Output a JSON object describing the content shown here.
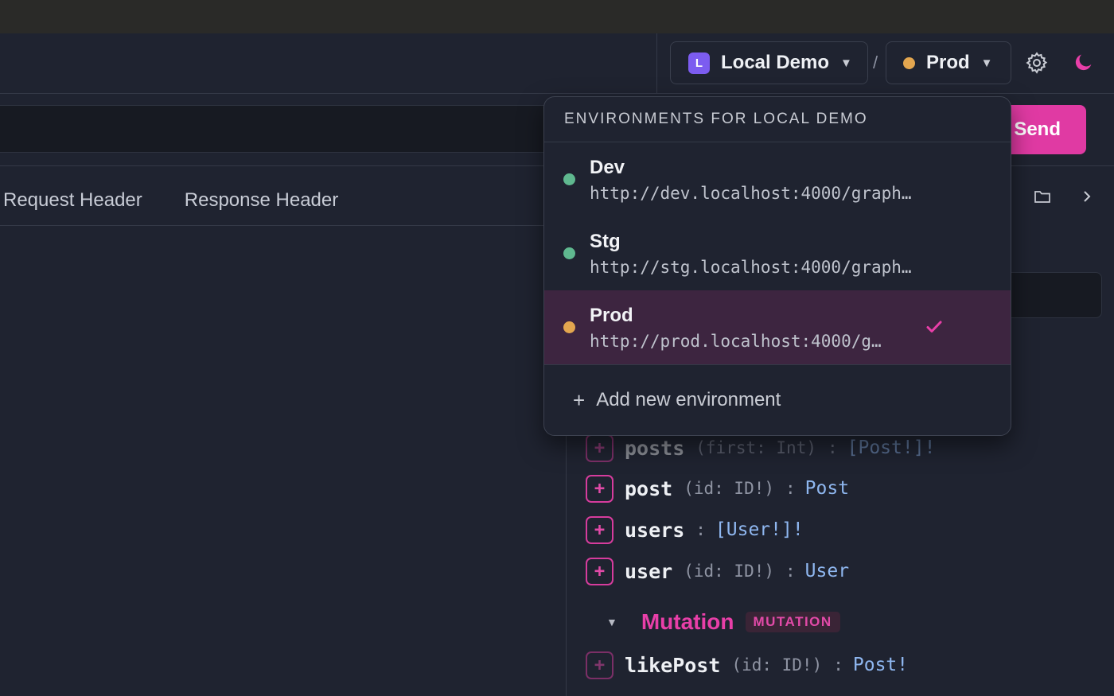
{
  "colors": {
    "accent": "#e03aa3",
    "workspace_badge": "#7c5cf0",
    "env_dev": "#5fb88f",
    "env_stg": "#5fb88f",
    "env_prod": "#e3a64f",
    "type_blue": "#8fb7f0"
  },
  "header": {
    "workspace": {
      "badge": "L",
      "label": "Local Demo",
      "caret": "▼"
    },
    "separator": "/",
    "environment": {
      "label": "Prod",
      "caret": "▼"
    },
    "settings_icon": "gear-icon",
    "theme_icon": "moon-icon"
  },
  "request": {
    "send_label": "Send"
  },
  "tabs": [
    {
      "label": "Request Header"
    },
    {
      "label": "Response Header"
    }
  ],
  "dropdown": {
    "header": "ENVIRONMENTS FOR LOCAL DEMO",
    "items": [
      {
        "name": "Dev",
        "url": "http://dev.localhost:4000/graph…",
        "active": false
      },
      {
        "name": "Stg",
        "url": "http://stg.localhost:4000/graph…",
        "active": false
      },
      {
        "name": "Prod",
        "url": "http://prod.localhost:4000/g…",
        "active": true
      }
    ],
    "add_label": "Add new environment",
    "add_icon": "+"
  },
  "schema": {
    "fields": [
      {
        "name": "posts",
        "args": "(first: Int)",
        "sep": ":",
        "type": "[Post!]!"
      },
      {
        "name": "post",
        "args": "(id: ID!)",
        "sep": ":",
        "type": "Post"
      },
      {
        "name": "users",
        "args": "",
        "sep": ":",
        "type": "[User!]!"
      },
      {
        "name": "user",
        "args": "(id: ID!)",
        "sep": ":",
        "type": "User"
      }
    ],
    "mutation": {
      "caret": "▼",
      "title": "Mutation",
      "badge": "MUTATION",
      "fields": [
        {
          "name": "likePost",
          "args": "(id: ID!)",
          "sep": ":",
          "type": "Post!"
        }
      ]
    }
  }
}
